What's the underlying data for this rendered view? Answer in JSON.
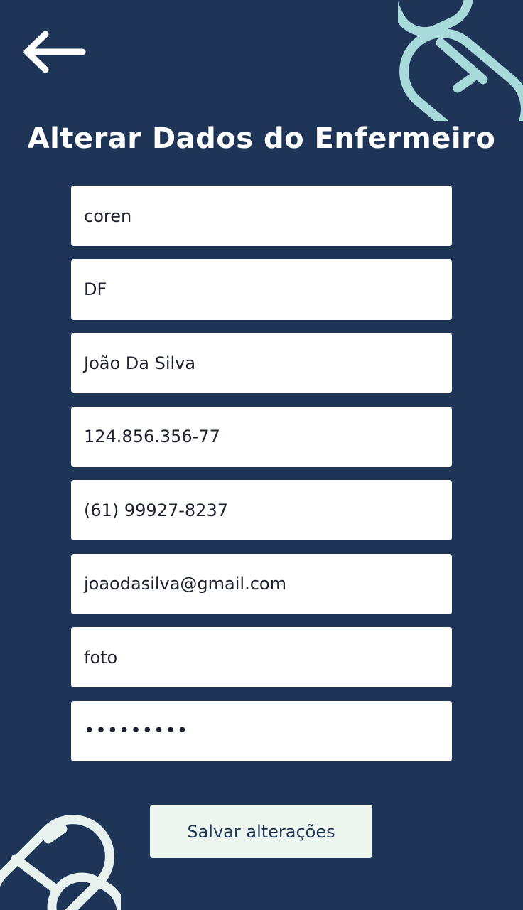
{
  "header": {
    "back_icon": "arrow-left-icon",
    "title": "Alterar Dados do Enfermeiro"
  },
  "form": {
    "coren": "coren",
    "uf": "DF",
    "name": "João Da Silva",
    "cpf": "124.856.356-77",
    "phone": "(61) 99927-8237",
    "email": "joaodasilva@gmail.com",
    "photo": "foto",
    "password": "•••••••••"
  },
  "actions": {
    "save_label": "Salvar alterações"
  },
  "decor": {
    "top_icon": "capsule-icon",
    "bottom_icon": "capsule-icon"
  },
  "colors": {
    "background": "#1f3557",
    "field_background": "#ffffff",
    "button_background": "#eef7ef",
    "capsule_stroke": "#a8dadc",
    "text_light": "#ffffff",
    "text_dark": "#1c2230"
  }
}
